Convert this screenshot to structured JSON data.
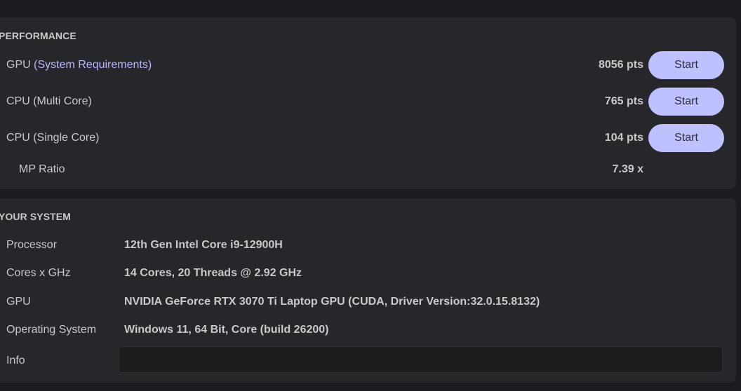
{
  "performance": {
    "title": "PERFORMANCE",
    "benchmarks": [
      {
        "label": "GPU",
        "link": "(System Requirements)",
        "score": "8056 pts",
        "button": "Start"
      },
      {
        "label": "CPU (Multi Core)",
        "score": "765 pts",
        "button": "Start"
      },
      {
        "label": "CPU (Single Core)",
        "score": "104 pts",
        "button": "Start"
      }
    ],
    "mp_ratio": {
      "label": "MP Ratio",
      "value": "7.39 x"
    }
  },
  "system": {
    "title": "YOUR SYSTEM",
    "rows": [
      {
        "key": "Processor",
        "value": "12th Gen Intel Core i9-12900H"
      },
      {
        "key": "Cores x GHz",
        "value": "14 Cores, 20 Threads @ 2.92 GHz"
      },
      {
        "key": "GPU",
        "value": "NVIDIA GeForce RTX 3070 Ti Laptop GPU (CUDA, Driver Version:32.0.15.8132)"
      },
      {
        "key": "Operating System",
        "value": "Windows 11, 64 Bit, Core (build 26200)"
      }
    ],
    "info": {
      "key": "Info",
      "value": ""
    }
  },
  "colors": {
    "background": "#1b1c1f",
    "panel": "#26272b",
    "accent_button": "#bfc0ff",
    "link": "#b8b9ff",
    "text": "#c9c9cc"
  }
}
